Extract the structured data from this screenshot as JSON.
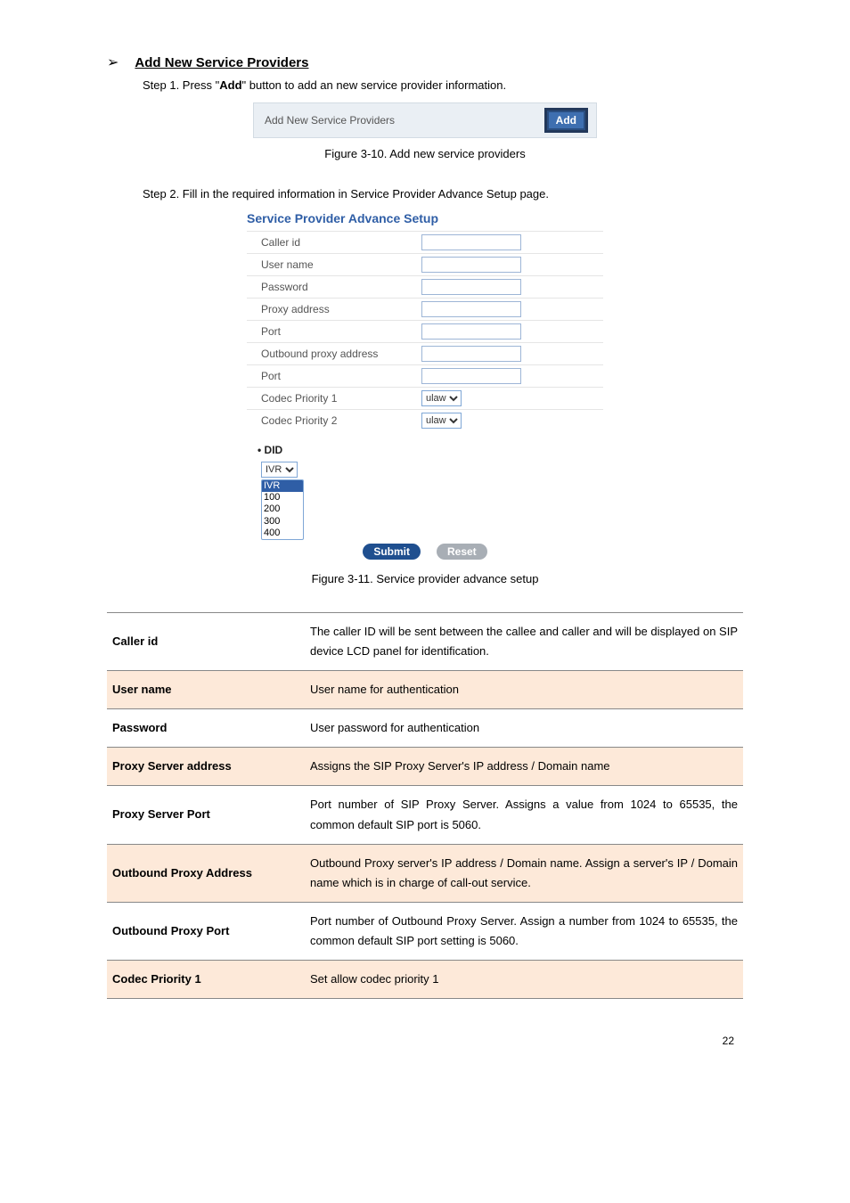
{
  "heading": {
    "title": "Add New Service Providers"
  },
  "steps": {
    "s1_pre": "Step 1. Press \"",
    "s1_bold": "Add",
    "s1_post": "\" button to add an new service provider information.",
    "s2": "Step 2. Fill in the required information in Service Provider Advance Setup page."
  },
  "panel1": {
    "label": "Add New Service Providers",
    "button": "Add"
  },
  "captions": {
    "c1": "Figure 3-10. Add new service providers",
    "c2": "Figure 3-11. Service provider advance setup"
  },
  "advance": {
    "title": "Service Provider Advance Setup",
    "rows": {
      "caller_id": "Caller id",
      "user_name": "User name",
      "password": "Password",
      "proxy_address": "Proxy address",
      "port1": "Port",
      "outbound_proxy": "Outbound proxy address",
      "port2": "Port",
      "codec1": "Codec Priority 1",
      "codec2": "Codec Priority 2"
    },
    "codec_value": "ulaw",
    "did_title": "DID",
    "did_selected": "IVR",
    "did_options": [
      "IVR",
      "100",
      "200",
      "300",
      "400"
    ],
    "submit": "Submit",
    "reset": "Reset"
  },
  "table": [
    {
      "key": "Caller id",
      "desc": "The caller ID will be sent between the callee and caller and will be displayed on SIP device LCD panel for identification.",
      "shade": false
    },
    {
      "key": "User name",
      "desc": "User name for authentication",
      "shade": true
    },
    {
      "key": "Password",
      "desc": "User password for authentication",
      "shade": false
    },
    {
      "key": "Proxy Server address",
      "desc": "Assigns the SIP Proxy Server's IP address / Domain name",
      "shade": true
    },
    {
      "key": "Proxy Server Port",
      "desc": "Port number of SIP Proxy Server. Assigns a value from 1024 to 65535, the common default SIP port is 5060.",
      "shade": false
    },
    {
      "key": "Outbound Proxy Address",
      "desc": "Outbound Proxy server's IP address / Domain name. Assign a server's IP / Domain name which is in charge of call-out service.",
      "shade": true
    },
    {
      "key": "Outbound Proxy Port",
      "desc": "Port number of Outbound Proxy Server. Assign a number from 1024 to 65535, the common default SIP port setting is 5060.",
      "shade": false
    },
    {
      "key": "Codec Priority 1",
      "desc": "Set allow codec priority 1",
      "shade": true
    }
  ],
  "page_number": "22"
}
